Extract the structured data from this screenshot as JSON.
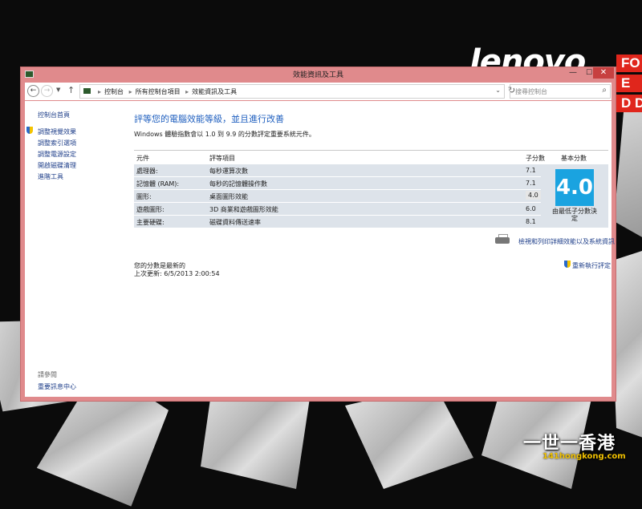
{
  "desktop": {
    "brand": "lenovo",
    "red_letters": [
      "FO",
      "E",
      "D DI"
    ],
    "watermark_text": "一世一香港",
    "watermark_url": "141hongkong.com"
  },
  "window": {
    "title": "效能資訊及工具",
    "buttons": {
      "minimize": "—",
      "maximize": "☐",
      "close": "✕"
    }
  },
  "toolbar": {
    "breadcrumbs": [
      "控制台",
      "所有控制台項目",
      "效能資訊及工具"
    ],
    "search_placeholder": "搜尋控制台"
  },
  "sidebar": {
    "home": "控制台首頁",
    "links": [
      "調整視覺效果",
      "調整索引選項",
      "調整電源設定",
      "開啟磁碟清理",
      "進階工具"
    ],
    "see_also_label": "請參閱",
    "see_also_link": "重要訊息中心"
  },
  "main": {
    "heading": "評等您的電腦效能等級，並且進行改善",
    "description": "Windows 體驗指數會以 1.0 到 9.9 的分數評定重要系統元件。",
    "columns": [
      "元件",
      "評等項目",
      "子分數",
      "基本分數"
    ],
    "rows": [
      {
        "component": "處理器:",
        "item": "每秒運算次數",
        "subscore": "7.1"
      },
      {
        "component": "記憶體 (RAM):",
        "item": "每秒的記憶體操作數",
        "subscore": "7.1"
      },
      {
        "component": "圖形:",
        "item": "桌面圖形效能",
        "subscore": "4.0"
      },
      {
        "component": "遊戲圖形:",
        "item": "3D 商業和遊戲圖形效能",
        "subscore": "6.0"
      },
      {
        "component": "主要硬碟:",
        "item": "磁碟資料傳送速率",
        "subscore": "8.1"
      }
    ],
    "base_score": "4.0",
    "base_caption": "由最低子分數決定",
    "print_link": "檢視和列印詳細效能以及系統資訊",
    "status_line1": "您的分數是最新的",
    "status_line2": "上次更新: 6/5/2013 2:00:54",
    "rerun_link": "重新執行評定"
  }
}
